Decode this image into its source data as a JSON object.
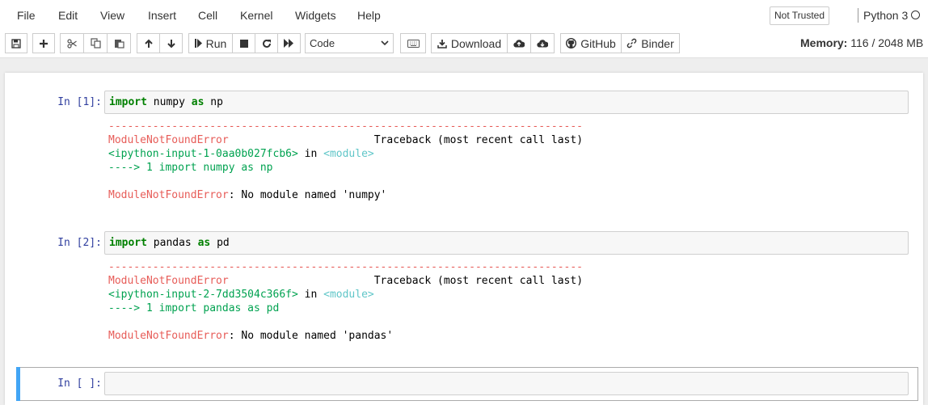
{
  "menubar": {
    "items": [
      "File",
      "Edit",
      "View",
      "Insert",
      "Cell",
      "Kernel",
      "Widgets",
      "Help"
    ],
    "trust_label": "Not Trusted",
    "kernel_name": "Python 3"
  },
  "toolbar": {
    "run_label": "Run",
    "cell_type": "Code",
    "download_label": "Download",
    "github_label": "GitHub",
    "binder_label": "Binder",
    "memory_label": "Memory:",
    "memory_value": "116 / 2048 MB"
  },
  "cells": [
    {
      "prompt": "In [1]:",
      "code_kw1": "import",
      "code_mod": " numpy ",
      "code_kw2": "as",
      "code_alias": " np",
      "output": {
        "dashes": "---------------------------------------------------------------------------",
        "error_name": "ModuleNotFoundError",
        "traceback_text": "Traceback (most recent call last)",
        "input_ref": "<ipython-input-1-0aa0b027fcb6>",
        "in_word": " in ",
        "module_ref": "<module>",
        "arrow_line": "----> 1 import numpy as np",
        "error_label": "ModuleNotFoundError",
        "error_message": ": No module named 'numpy'"
      }
    },
    {
      "prompt": "In [2]:",
      "code_kw1": "import",
      "code_mod": " pandas ",
      "code_kw2": "as",
      "code_alias": " pd",
      "output": {
        "dashes": "---------------------------------------------------------------------------",
        "error_name": "ModuleNotFoundError",
        "traceback_text": "Traceback (most recent call last)",
        "input_ref": "<ipython-input-2-7dd3504c366f>",
        "in_word": " in ",
        "module_ref": "<module>",
        "arrow_line": "----> 1 import pandas as pd",
        "error_label": "ModuleNotFoundError",
        "error_message": ": No module named 'pandas'"
      }
    },
    {
      "prompt": "In [ ]:"
    }
  ],
  "colors": {
    "prompt": "#303f9f",
    "error_red": "#e75c58",
    "path_green": "#00a250",
    "module_cyan": "#60c6c8",
    "selected_cell": "#42a5f5"
  },
  "icons": [
    "save-icon",
    "plus-icon",
    "cut-icon",
    "copy-icon",
    "paste-icon",
    "arrow-up-icon",
    "arrow-down-icon",
    "step-forward-icon",
    "stop-icon",
    "restart-icon",
    "fast-forward-icon",
    "keyboard-icon",
    "download-icon",
    "cloud-upload-icon",
    "cloud-download-icon",
    "github-icon",
    "link-icon"
  ]
}
